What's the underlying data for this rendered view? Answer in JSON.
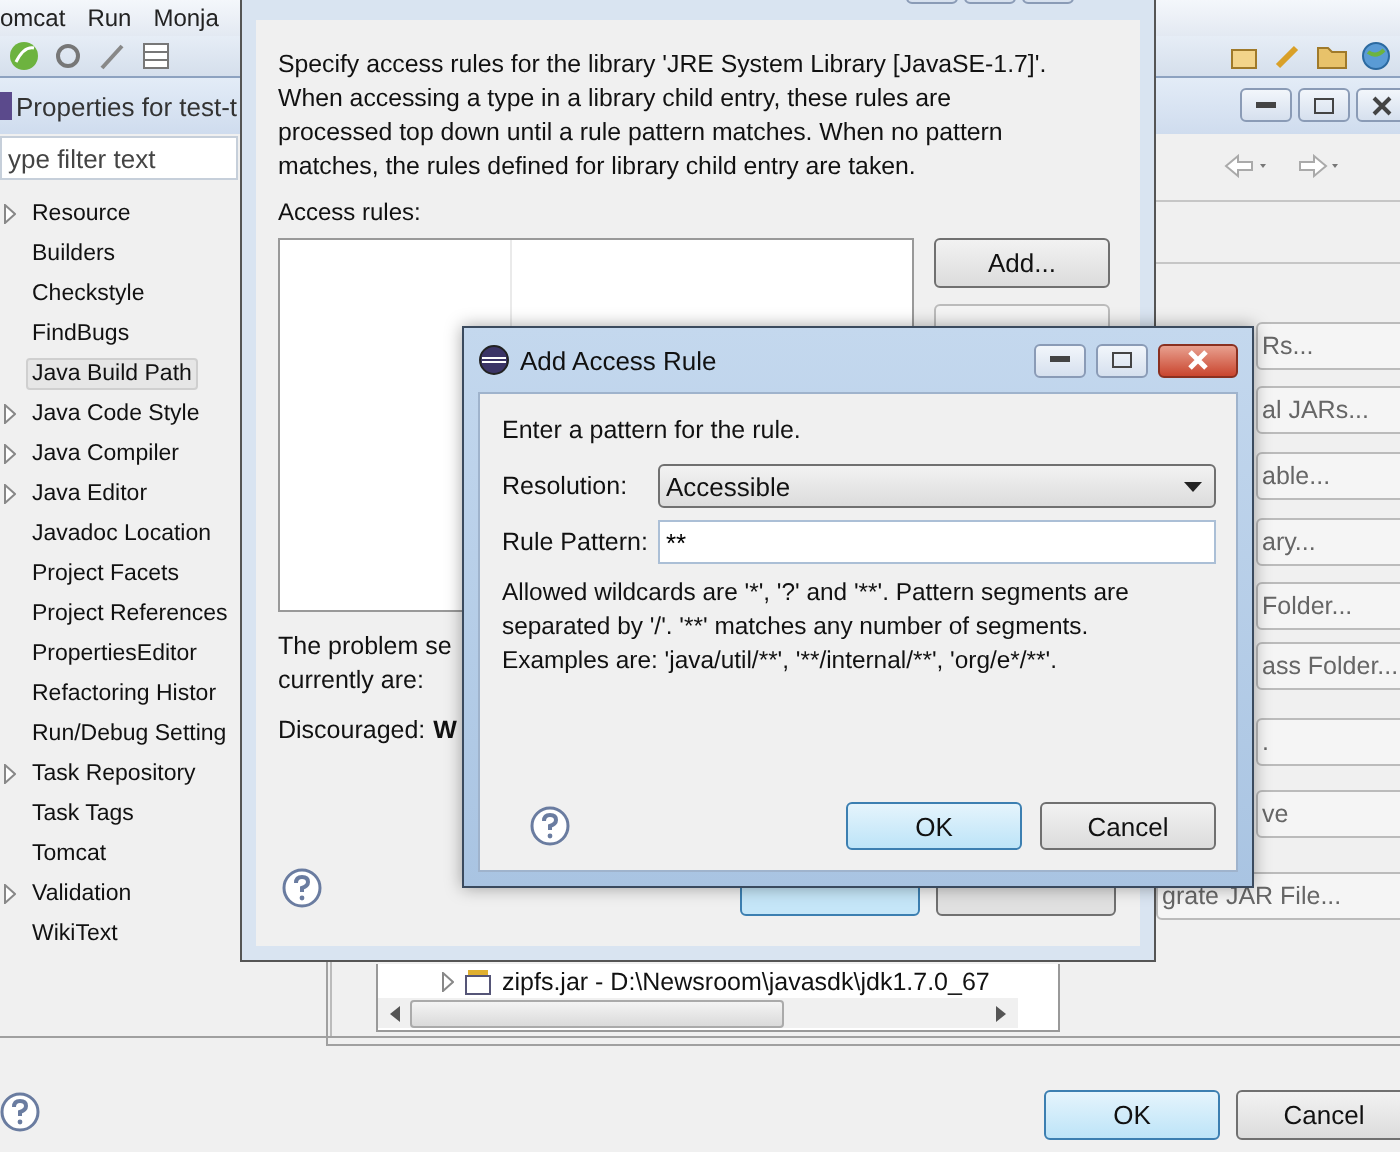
{
  "menu_bar": {
    "items": [
      "omcat",
      "Run",
      "Monja"
    ]
  },
  "properties_window": {
    "title": "Properties for test-t",
    "filter": {
      "placeholder": "ype filter text"
    },
    "tree": [
      {
        "label": "Resource",
        "expandable": true,
        "selected": false
      },
      {
        "label": "Builders",
        "expandable": false,
        "selected": false
      },
      {
        "label": "Checkstyle",
        "expandable": false,
        "selected": false
      },
      {
        "label": "FindBugs",
        "expandable": false,
        "selected": false
      },
      {
        "label": "Java Build Path",
        "expandable": false,
        "selected": true
      },
      {
        "label": "Java Code Style",
        "expandable": true,
        "selected": false
      },
      {
        "label": "Java Compiler",
        "expandable": true,
        "selected": false
      },
      {
        "label": "Java Editor",
        "expandable": true,
        "selected": false
      },
      {
        "label": "Javadoc Location",
        "expandable": false,
        "selected": false
      },
      {
        "label": "Project Facets",
        "expandable": false,
        "selected": false
      },
      {
        "label": "Project References",
        "expandable": false,
        "selected": false
      },
      {
        "label": "PropertiesEditor",
        "expandable": false,
        "selected": false
      },
      {
        "label": "Refactoring Histor",
        "expandable": false,
        "selected": false
      },
      {
        "label": "Run/Debug Setting",
        "expandable": false,
        "selected": false
      },
      {
        "label": "Task Repository",
        "expandable": true,
        "selected": false
      },
      {
        "label": "Task Tags",
        "expandable": false,
        "selected": false
      },
      {
        "label": "Tomcat",
        "expandable": false,
        "selected": false
      },
      {
        "label": "Validation",
        "expandable": true,
        "selected": false
      },
      {
        "label": "WikiText",
        "expandable": false,
        "selected": false
      }
    ],
    "side_buttons": [
      "Rs...",
      "al JARs...",
      "able...",
      "ary...",
      "Folder...",
      "ass Folder...",
      ".",
      "ve",
      "grate JAR File..."
    ],
    "library_row": "zipfs.jar - D:\\Newsroom\\javasdk\\jdk1.7.0_67",
    "buttons": [
      "OK",
      "Cancel"
    ]
  },
  "type_access_rules_dialog": {
    "description": [
      "Specify access rules for the library 'JRE System Library [JavaSE-1.7]'.",
      "When accessing a type in a library child entry, these rules are",
      "processed top down until a rule pattern matches. When no pattern",
      "matches, the rules defined for library child entry are taken."
    ],
    "access_rules_label": "Access rules:",
    "buttons": [
      "Add..."
    ],
    "problem_text": [
      "The problem se",
      "currently are:"
    ],
    "discouraged": {
      "label": "Discouraged:",
      "value": "W"
    }
  },
  "add_access_rule_dialog": {
    "title": "Add Access Rule",
    "prompt": "Enter a pattern for the rule.",
    "resolution": {
      "label": "Resolution:",
      "value": "Accessible"
    },
    "rule_pattern": {
      "label": "Rule Pattern:",
      "value": "**"
    },
    "hint": [
      "Allowed wildcards are '*', '?' and '**'. Pattern segments are",
      "separated by '/'. '**' matches any number of segments.",
      "Examples are: 'java/util/**', '**/internal/**', 'org/e*/**'."
    ],
    "buttons": [
      {
        "label": "OK",
        "default": true
      },
      {
        "label": "Cancel",
        "default": false
      }
    ]
  }
}
